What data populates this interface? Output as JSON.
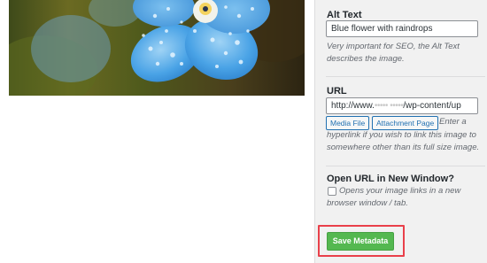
{
  "image": {
    "description_icon": "blue-flower-photo"
  },
  "alt_text": {
    "label": "Alt Text",
    "value": "Blue flower with raindrops",
    "help": "Very important for SEO, the Alt Text describes the image."
  },
  "url": {
    "label": "URL",
    "value_prefix": "http://www.",
    "value_masked": "••••• •••••",
    "value_suffix": "/wp-content/up",
    "media_file_button": "Media File",
    "attachment_page_button": "Attachment Page",
    "help_inline": "Enter a",
    "help_rest": "hyperlink if you wish to link this image to somewhere other than its full size image."
  },
  "new_window": {
    "label": "Open URL in New Window?",
    "checkbox_text": "Opens your image links in a new browser window / tab.",
    "checked": false
  },
  "save": {
    "label": "Save Metadata"
  },
  "colors": {
    "primary": "#2271b1",
    "save_green": "#54b850",
    "highlight_red": "#e9404a",
    "panel_bg": "#f1f1f1"
  }
}
